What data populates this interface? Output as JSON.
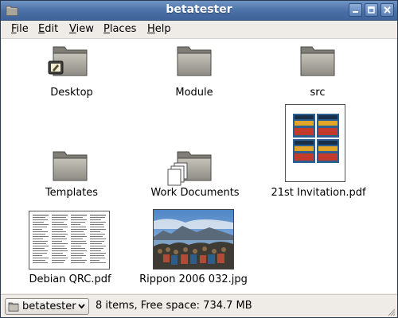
{
  "window": {
    "title": "betatester",
    "buttons": [
      "minimize-icon",
      "maximize-icon",
      "close-icon"
    ]
  },
  "menubar": {
    "items": [
      {
        "label": "File",
        "mnemonic": "F",
        "rest": "ile"
      },
      {
        "label": "Edit",
        "mnemonic": "E",
        "rest": "dit"
      },
      {
        "label": "View",
        "mnemonic": "V",
        "rest": "iew"
      },
      {
        "label": "Places",
        "mnemonic": "P",
        "rest": "laces"
      },
      {
        "label": "Help",
        "mnemonic": "H",
        "rest": "elp"
      }
    ]
  },
  "files": [
    {
      "label": "Desktop",
      "icon": "desktop-folder-icon"
    },
    {
      "label": "Module",
      "icon": "folder-icon"
    },
    {
      "label": "src",
      "icon": "folder-icon"
    },
    {
      "label": "Templates",
      "icon": "templates-folder-icon"
    },
    {
      "label": "Work Documents",
      "icon": "documents-folder-icon"
    },
    {
      "label": "21st Invitation.pdf",
      "icon": "pdf-thumbnail"
    },
    {
      "label": "Debian QRC.pdf",
      "icon": "pdf-thumbnail"
    },
    {
      "label": "Rippon 2006 032.jpg",
      "icon": "photo-thumbnail"
    }
  ],
  "statusbar": {
    "location": "betatester",
    "info": "8 items, Free space: 734.7 MB"
  },
  "colors": {
    "titlebar": "#4a6fa5",
    "folder": "#9c9a92",
    "content_bg": "#ffffff"
  }
}
